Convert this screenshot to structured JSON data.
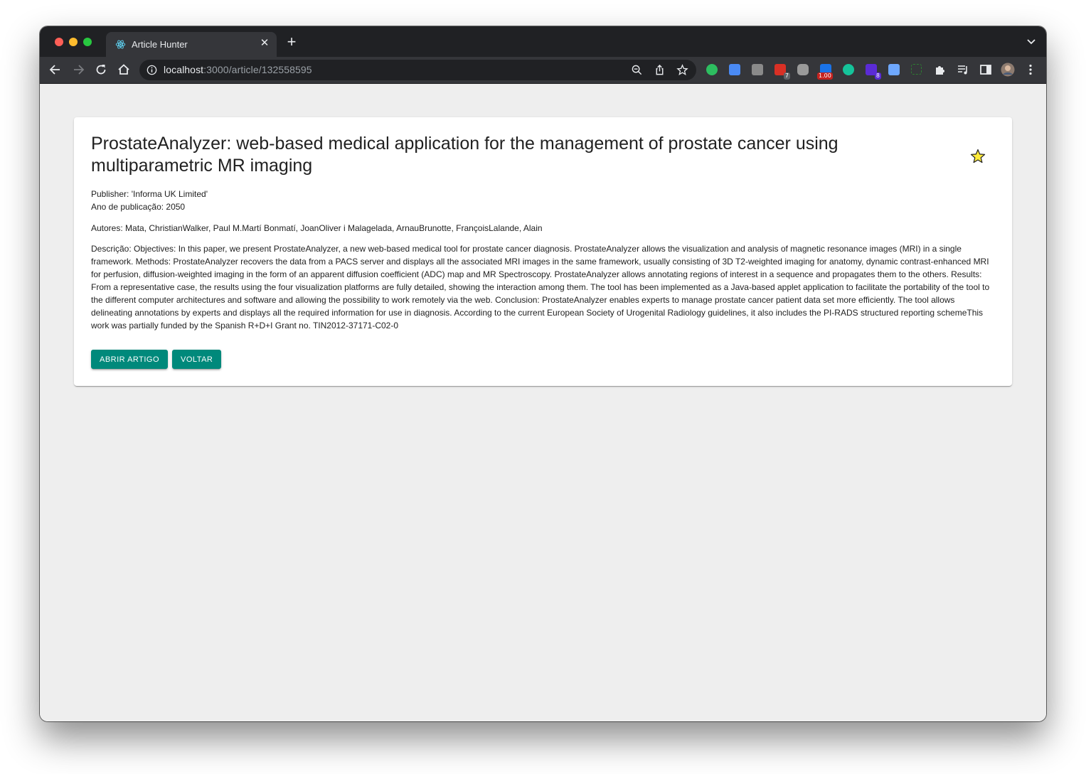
{
  "browser": {
    "tab": {
      "title": "Article Hunter",
      "close": "✕"
    },
    "new_tab": "+",
    "url": {
      "host": "localhost",
      "rest": ":3000/article/132558595"
    },
    "extensions": [
      {
        "name": "evernote-icon",
        "color": "#2dbe60"
      },
      {
        "name": "google-translate-icon",
        "color": "#4a8af4"
      },
      {
        "name": "extension-gray-icon",
        "color": "#8a8a8a"
      },
      {
        "name": "calendar-extension-icon",
        "color": "#d93025",
        "badge": "7"
      },
      {
        "name": "mastodon-icon",
        "color": "#9a9a9a"
      },
      {
        "name": "playback-speed-icon",
        "color": "#1a73e8",
        "badge": "1.00"
      },
      {
        "name": "grammarly-icon",
        "color": "#15c39a"
      },
      {
        "name": "purple-extension-icon",
        "color": "#5b2bd6",
        "badge": "8"
      },
      {
        "name": "clipboard-extension-icon",
        "color": "#6ea8ff"
      },
      {
        "name": "screenshot-extension-icon",
        "color": "#2e7d32"
      }
    ]
  },
  "article": {
    "title": "ProstateAnalyzer: web-based medical application for the management of prostate cancer using multiparametric MR imaging",
    "publisher": "Publisher: 'Informa UK Limited'",
    "year": "Ano de publicação: 2050",
    "authors": "Autores: Mata, ChristianWalker, Paul M.Martí Bonmatí, JoanOliver i Malagelada, ArnauBrunotte, FrançoisLalande, Alain",
    "description": "Descrição: Objectives: In this paper, we present ProstateAnalyzer, a new web-based medical tool for prostate cancer diagnosis. ProstateAnalyzer allows the visualization and analysis of magnetic resonance images (MRI) in a single framework. Methods: ProstateAnalyzer recovers the data from a PACS server and displays all the associated MRI images in the same framework, usually consisting of 3D T2-weighted imaging for anatomy, dynamic contrast-enhanced MRI for perfusion, diffusion-weighted imaging in the form of an apparent diffusion coefficient (ADC) map and MR Spectroscopy. ProstateAnalyzer allows annotating regions of interest in a sequence and propagates them to the others. Results: From a representative case, the results using the four visualization platforms are fully detailed, showing the interaction among them. The tool has been implemented as a Java-based applet application to facilitate the portability of the tool to the different computer architectures and software and allowing the possibility to work remotely via the web. Conclusion: ProstateAnalyzer enables experts to manage prostate cancer patient data set more efficiently. The tool allows delineating annotations by experts and displays all the required information for use in diagnosis. According to the current European Society of Urogenital Radiology guidelines, it also includes the PI-RADS structured reporting schemeThis work was partially funded by the Spanish R+D+I Grant no. TIN2012-37171-C02-0",
    "favorite_color": "#ffeb3b",
    "buttons": {
      "open": "ABRIR ARTIGO",
      "back": "VOLTAR"
    },
    "button_color": "#00897b"
  }
}
